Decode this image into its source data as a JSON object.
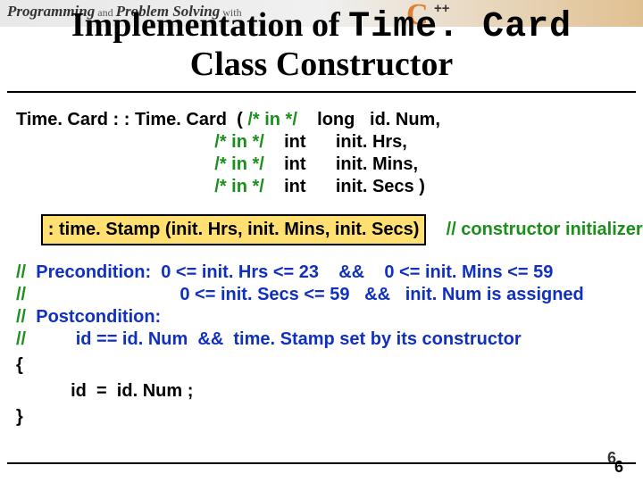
{
  "header": {
    "prog": "Programming",
    "and": " and ",
    "ps": "Problem Solving",
    "with": " with",
    "c": "C",
    "pp": "++"
  },
  "title": {
    "line1a": "Implementation of ",
    "line1b": "Time. Card",
    "line2": "Class Constructor"
  },
  "sig": {
    "r0a": "Time. Card : : Time. Card  ( ",
    "r0b": "/* in */",
    "r0c": "    long   id. Num,",
    "pad": "                                        ",
    "r1c": "    int      init. Hrs,",
    "r2c": "    int      init. Mins,",
    "r3c": "    int      init. Secs )"
  },
  "init": {
    "lead": "     ",
    "box": ": time. Stamp (init. Hrs, init. Mins, init. Secs)",
    "tail": "    ",
    "cmt": "// constructor initializer"
  },
  "pre": {
    "l0": "Precondition:  0 <= init. Hrs <= 23    &&    0 <= init. Mins <= 59",
    "l1": "                             0 <= init. Secs <= 59   &&   init. Num is assigned",
    "l2": "Postcondition:",
    "l3": "        id == id. Num  &&  time. Stamp set by its constructor"
  },
  "body": {
    "open": "{",
    "stmt": "           id  =  id. Num ;",
    "close": "}"
  },
  "page": {
    "outer": "6",
    "inner": "6"
  }
}
